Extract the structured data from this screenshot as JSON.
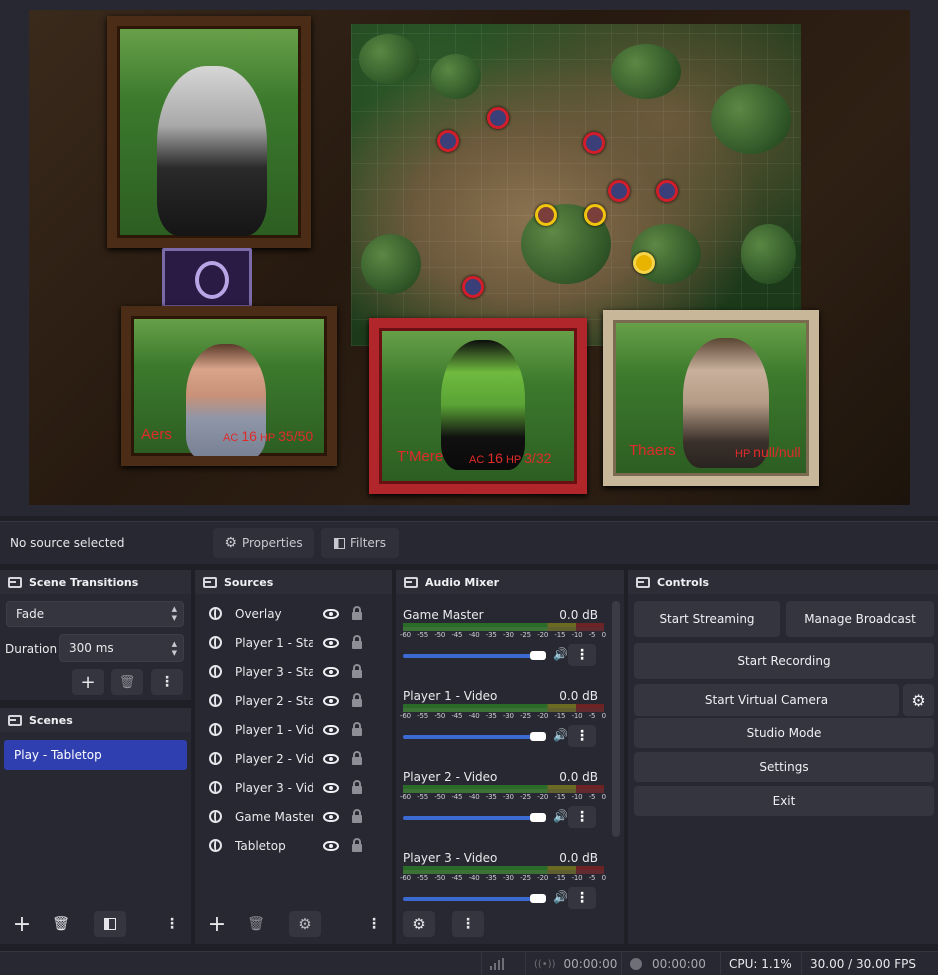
{
  "preview": {
    "players": [
      {
        "name": "Aers",
        "ac_label": "AC",
        "ac": "16",
        "hp_label": "HP",
        "hp": "35/50"
      },
      {
        "name": "T'Mere",
        "ac_label": "AC",
        "ac": "16",
        "hp_label": "HP",
        "hp": "3/32"
      },
      {
        "name": "Thaers",
        "hp_label": "HP",
        "hp": "null/null"
      }
    ]
  },
  "source_bar": {
    "status": "No source selected",
    "properties_label": "Properties",
    "filters_label": "Filters"
  },
  "scene_transitions": {
    "title": "Scene Transitions",
    "transition": "Fade",
    "duration_label": "Duration",
    "duration_value": "300 ms"
  },
  "scenes": {
    "title": "Scenes",
    "items": [
      "Play - Tabletop"
    ]
  },
  "sources": {
    "title": "Sources",
    "items": [
      "Overlay",
      "Player 1 - Stat",
      "Player 3 - Stat",
      "Player 2 - Stat",
      "Player 1 - Vide",
      "Player 2 - Vide",
      "Player 3 - Vide",
      "Game Master",
      "Tabletop"
    ]
  },
  "audio_mixer": {
    "title": "Audio Mixer",
    "scale": [
      "-60",
      "-55",
      "-50",
      "-45",
      "-40",
      "-35",
      "-30",
      "-25",
      "-20",
      "-15",
      "-10",
      "-5",
      "0"
    ],
    "channels": [
      {
        "name": "Game Master",
        "level": "0.0 dB",
        "volume": 1.0
      },
      {
        "name": "Player 1 - Video",
        "level": "0.0 dB",
        "volume": 1.0
      },
      {
        "name": "Player 2 - Video",
        "level": "0.0 dB",
        "volume": 1.0
      },
      {
        "name": "Player 3 - Video",
        "level": "0.0 dB",
        "volume": 1.0
      }
    ]
  },
  "controls": {
    "title": "Controls",
    "start_streaming": "Start Streaming",
    "manage_broadcast": "Manage Broadcast",
    "start_recording": "Start Recording",
    "start_virtual_camera": "Start Virtual Camera",
    "studio_mode": "Studio Mode",
    "settings": "Settings",
    "exit": "Exit"
  },
  "status_bar": {
    "stream_time": "00:00:00",
    "record_time": "00:00:00",
    "cpu": "CPU: 1.1%",
    "fps": "30.00 / 30.00 FPS"
  },
  "icons": {
    "add": "plus-icon",
    "remove": "trash-icon",
    "filter": "filter-icon",
    "menu": "kebab-icon",
    "settings": "gear-icon",
    "visibility": "eye-icon",
    "lock": "lock-icon",
    "speaker": "speaker-icon"
  },
  "colors": {
    "accent": "#2f3fb0",
    "volume": "#3b6ad3",
    "player_text": "#e02b2b"
  }
}
